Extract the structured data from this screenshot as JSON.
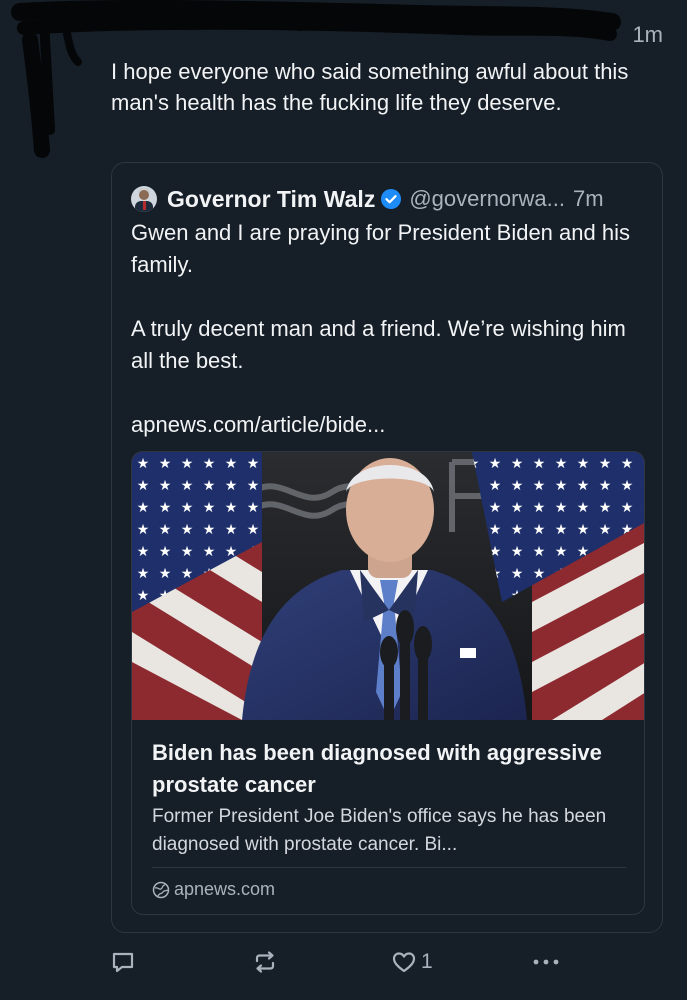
{
  "post": {
    "time": "1m",
    "text": "I hope everyone who said something awful about this man's health has the fucking life they deserve."
  },
  "quote": {
    "author_name": "Governor Tim Walz",
    "handle": "@governorwa...",
    "time": "7m",
    "paragraphs": [
      "Gwen and I are praying for President Biden and his family.",
      "A truly decent man and a friend. We’re wishing him all the best.",
      "apnews.com/article/bide..."
    ],
    "link_card": {
      "title": "Biden has been diagnosed with aggressive prostate cancer",
      "description": "Former President Joe Biden's office says he has been diagnosed with prostate cancer. Bi...",
      "domain": "apnews.com"
    }
  },
  "actions": {
    "reply_icon": "reply-icon",
    "repost_icon": "repost-icon",
    "like_icon": "heart-icon",
    "like_count": "1",
    "more_icon": "more-icon"
  },
  "colors": {
    "background": "#161e27",
    "border": "#2c3743",
    "text": "#f1f3f5",
    "muted": "#aab2bd",
    "verified": "#1d8cf8"
  }
}
